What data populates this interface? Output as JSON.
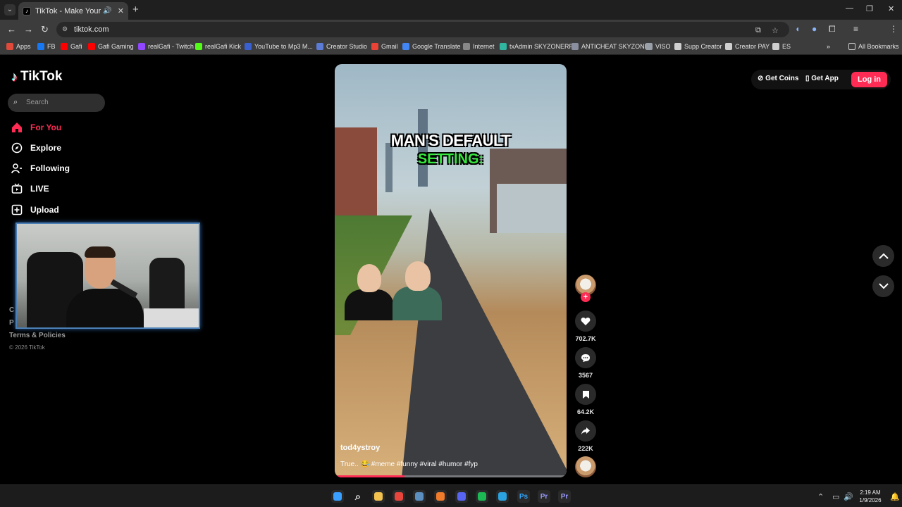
{
  "browser": {
    "tab_title": "TikTok - Make Your Day",
    "url": "tiktok.com",
    "bookmarks": [
      {
        "label": "Apps",
        "color": "#e04a3a"
      },
      {
        "label": "FB",
        "color": "#1877f2"
      },
      {
        "label": "Gafi",
        "color": "#ff0000"
      },
      {
        "label": "Gafi Gaming",
        "color": "#ff0000"
      },
      {
        "label": "realGafi - Twitch",
        "color": "#9146ff"
      },
      {
        "label": "realGafi Kick",
        "color": "#53fc18"
      },
      {
        "label": "YouTube to Mp3 M...",
        "color": "#3a5fcf"
      },
      {
        "label": "Creator Studio",
        "color": "#5b7bd5"
      },
      {
        "label": "Gmail",
        "color": "#ea4335"
      },
      {
        "label": "Google Translate",
        "color": "#4285f4"
      },
      {
        "label": "Internet",
        "color": "#888888"
      },
      {
        "label": "txAdmin SKYZONERP",
        "color": "#2fb5a0"
      },
      {
        "label": "ANTICHEAT SKYZONE",
        "color": "#8a8fa0"
      },
      {
        "label": "VISO",
        "color": "#9aa0a8"
      },
      {
        "label": "Supp Creator",
        "color": "#cfcfcf"
      },
      {
        "label": "Creator PAY",
        "color": "#cfcfcf"
      },
      {
        "label": "ES",
        "color": "#cfcfcf"
      }
    ],
    "all_bookmarks": "All Bookmarks"
  },
  "sidebar": {
    "logo": "TikTok",
    "search_placeholder": "Search",
    "nav": [
      {
        "label": "For You",
        "icon": "home-icon",
        "active": true
      },
      {
        "label": "Explore",
        "icon": "compass-icon",
        "active": false
      },
      {
        "label": "Following",
        "icon": "user-follow-icon",
        "active": false
      },
      {
        "label": "LIVE",
        "icon": "live-tv-icon",
        "active": false
      },
      {
        "label": "Upload",
        "icon": "plus-square-icon",
        "active": false
      }
    ],
    "footer": {
      "partial_1": "C",
      "partial_2": "P",
      "terms": "Terms & Policies",
      "copyright": "© 2026 TikTok"
    }
  },
  "video": {
    "caption_line1": "MAN'S DEFAULT",
    "caption_line2": "SETTING:",
    "author": "tod4ystroy",
    "description": "True.. 😂 #meme #funny #viral #humor #fyp",
    "progress": 0.3
  },
  "actions": {
    "likes": "702.7K",
    "comments": "3567",
    "saves": "64.2K",
    "shares": "222K"
  },
  "header": {
    "get_coins": "Get Coins",
    "get_app": "Get App",
    "login": "Log in"
  },
  "taskbar": {
    "time": "2:19 AM",
    "date": "1/9/2026",
    "apps": [
      {
        "name": "windows-start",
        "color": "#3aa0ff"
      },
      {
        "name": "search",
        "color": "#dddddd"
      },
      {
        "name": "file-explorer",
        "color": "#f2c14e"
      },
      {
        "name": "chrome",
        "color": "#e8453c"
      },
      {
        "name": "steam",
        "color": "#5b8fbf"
      },
      {
        "name": "app-orange",
        "color": "#f07b2b"
      },
      {
        "name": "discord",
        "color": "#5865f2"
      },
      {
        "name": "spotify",
        "color": "#1db954"
      },
      {
        "name": "telegram",
        "color": "#2aa3e0"
      },
      {
        "name": "photoshop",
        "color": "#31a8ff"
      },
      {
        "name": "premiere",
        "color": "#9999ff"
      },
      {
        "name": "premiere-2",
        "color": "#9999ff"
      }
    ],
    "app_labels": {
      "photoshop": "Ps",
      "premiere": "Pr",
      "premiere-2": "Pr"
    }
  },
  "colors": {
    "accent": "#fe2c55",
    "background": "#000000",
    "caption_green": "#35e83d"
  }
}
